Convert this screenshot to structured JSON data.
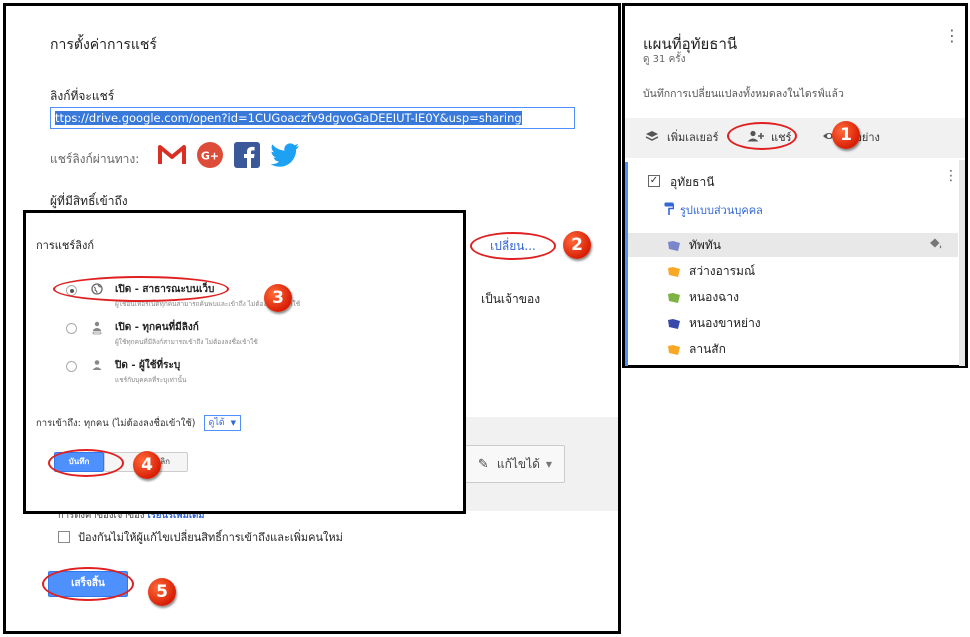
{
  "left_panel": {
    "title": "การตั้งค่าการแชร์",
    "link_heading": "ลิงก์ที่จะแชร์",
    "link_value": "ttps://drive.google.com/open?id=1CUGoaczfv9dgvoGaDEEIUT-IE0Y&usp=sharing",
    "share_via_label": "แชร์ลิงก์ผ่านทาง:",
    "share_icons": [
      "gmail-icon",
      "google-plus-icon",
      "facebook-icon",
      "twitter-icon"
    ],
    "access_heading": "ผู้ที่มีสิทธิ์เข้าถึง",
    "change_link": "เปลี่ยน...",
    "owner_label": "เป็นเจ้าของ",
    "edit_button": "แก้ไขได้",
    "owner_settings_prefix": "การตั้งค่าของเจ้าของ",
    "owner_settings_link": "เรียนรู้เพิ่มเติม",
    "prevent_label": "ป้องกันไม่ให้ผู้แก้ไขเปลี่ยนสิทธิ์การเข้าถึงและเพิ่มคนใหม่",
    "done_button": "เสร็จสิ้น"
  },
  "link_dialog": {
    "title": "การแชร์ลิงก์",
    "options": [
      {
        "title": "เปิด - สาธารณะบนเว็บ",
        "desc": "ผู้ใช้อินเทอร์เน็ตทุกคนสามารถค้นพบและเข้าถึง ไม่ต้องลงชื่อเข้าใช้",
        "icon": "globe-icon",
        "selected": true
      },
      {
        "title": "เปิด - ทุกคนที่มีลิงก์",
        "desc": "ผู้ใช้ทุกคนที่มีลิงก์สามารถเข้าถึง ไม่ต้องลงชื่อเข้าใช้",
        "icon": "link-people-icon",
        "selected": false
      },
      {
        "title": "ปิด - ผู้ใช้ที่ระบุ",
        "desc": "แชร์กับบุคคลที่ระบุเท่านั้น",
        "icon": "person-icon",
        "selected": false
      }
    ],
    "access_label": "การเข้าถึง:  ทุกคน (ไม่ต้องลงชื่อเข้าใช้)",
    "access_value": "ดูได้",
    "save_button": "บันทึก",
    "cancel_button": "ยกเลิก"
  },
  "right_panel": {
    "map_title": "แผนที่อุทัยธานี",
    "view_count": "ดู 31 ครั้ง",
    "saved_msg": "บันทึกการเปลี่ยนแปลงทั้งหมดลงในไดรฟ์แล้ว",
    "add_layer": "เพิ่มเลเยอร์",
    "share": "แชร์",
    "preview": "ตัวอย่าง",
    "layer_title": "อุทัยธานี",
    "style_link": "รูปแบบส่วนบุคคล",
    "places": [
      {
        "name": "ทัพทัน",
        "color": "#7986cb"
      },
      {
        "name": "สว่างอารมณ์",
        "color": "#f9a825"
      },
      {
        "name": "หนองฉาง",
        "color": "#7cb342"
      },
      {
        "name": "หนองขาหย่าง",
        "color": "#3949ab"
      },
      {
        "name": "ลานสัก",
        "color": "#f9a825"
      }
    ]
  },
  "steps": [
    "1",
    "2",
    "3",
    "4",
    "5"
  ],
  "colors": {
    "accent": "#4d90fe",
    "annotation_red": "#e02020",
    "link": "#3367d6"
  }
}
